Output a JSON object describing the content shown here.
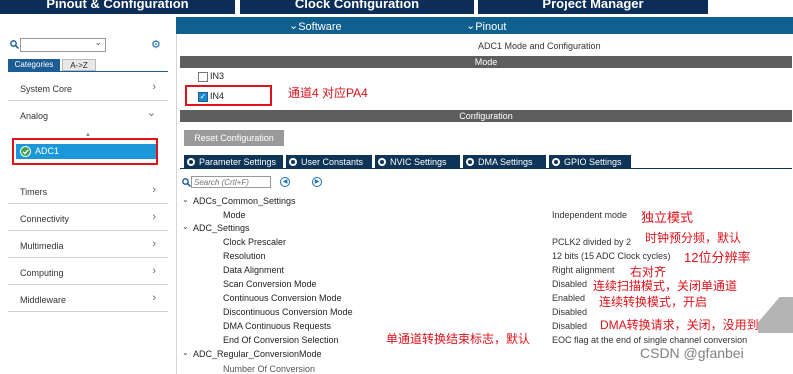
{
  "top_tabs": [
    "Pinout & Configuration",
    "Clock Configuration",
    "Project Manager"
  ],
  "sub_bar": {
    "software_packs": "Software Packs",
    "pinout": "Pinout"
  },
  "left": {
    "categories_tab": "Categories",
    "az_tab": "A->Z",
    "nav": [
      {
        "label": "System Core"
      },
      {
        "label": "Analog"
      },
      {
        "label": "ADC1"
      },
      {
        "label": "Timers"
      },
      {
        "label": "Connectivity"
      },
      {
        "label": "Multimedia"
      },
      {
        "label": "Computing"
      },
      {
        "label": "Middleware"
      }
    ]
  },
  "panel_title": "ADC1 Mode and Configuration",
  "mode_header": "Mode",
  "channels": [
    {
      "label": "IN3",
      "checked": false
    },
    {
      "label": "IN4",
      "checked": true
    }
  ],
  "config_header": "Configuration",
  "reset_button": "Reset Configuration",
  "tabs": [
    "Parameter Settings",
    "User Constants",
    "NVIC Settings",
    "DMA Settings",
    "GPIO Settings"
  ],
  "search_placeholder": "Search (Crtl+F)",
  "params": {
    "common_group": "ADCs_Common_Settings",
    "mode_label": "Mode",
    "mode_value": "Independent mode",
    "adc_group": "ADC_Settings",
    "rows": [
      {
        "label": "Clock Prescaler",
        "value": "PCLK2 divided by 2"
      },
      {
        "label": "Resolution",
        "value": "12 bits (15 ADC Clock cycles)"
      },
      {
        "label": "Data Alignment",
        "value": "Right alignment"
      },
      {
        "label": "Scan Conversion Mode",
        "value": "Disabled"
      },
      {
        "label": "Continuous Conversion Mode",
        "value": "Enabled"
      },
      {
        "label": "Discontinuous Conversion Mode",
        "value": "Disabled"
      },
      {
        "label": "DMA Continuous Requests",
        "value": "Disabled"
      },
      {
        "label": "End Of Conversion Selection",
        "value": "EOC flag at the end of single channel conversion"
      }
    ],
    "regular_group": "ADC_Regular_ConversionMode",
    "cut_row": "Number Of Conversion"
  },
  "annotations": {
    "in4": "通道4 对应PA4",
    "mode": "独立模式",
    "prescaler": "时钟预分频，默认",
    "resolution": "12位分辨率",
    "align": "右对齐",
    "scan": "连续扫描模式，关闭单通道",
    "continuous": "连续转换模式，开启",
    "dma": "DMA转换请求，关闭，没用到",
    "eoc": "单通道转换结束标志，默认"
  },
  "watermark": "CSDN @gfanbei",
  "colors": {
    "accent": "#0b2d57",
    "annotation": "#e0121a",
    "selected": "#1c97d7"
  }
}
